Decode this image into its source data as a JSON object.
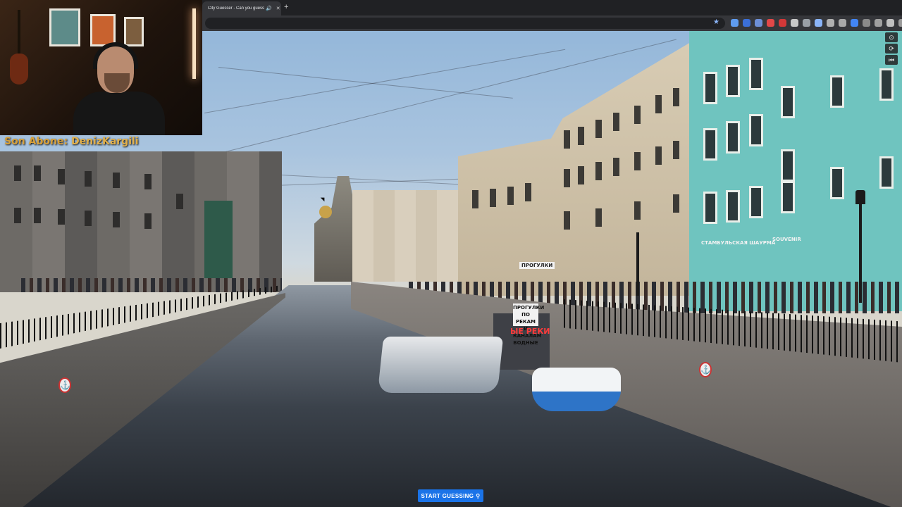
{
  "browser": {
    "tab_title": "City Guesser - Can you guess",
    "new_tab_glyph": "+",
    "close_glyph": "✕",
    "audio_glyph": "🔊",
    "star_glyph": "★"
  },
  "overlay": {
    "subscriber_label": "Son Abone:",
    "subscriber_name": "DenizKargili"
  },
  "scene": {
    "shop_signs": {
      "kiosk_sign": "ПРОГУЛКИ ПО РЕКАМ И КАНАЛАМ ВОДНЫЕ",
      "red_sign": "ЫЕ РЕКИ",
      "small_sign": "ПРОГУЛКИ",
      "left_sign": "СТАМБУЛЬСКАЯ ШАУРМА",
      "right_sign": "SOUVENIR"
    }
  },
  "controls": {
    "compass_glyph": "⊙",
    "reset_glyph": "⟳",
    "back_glyph": "⏮"
  },
  "start_button": {
    "label": "START GUESSING",
    "pin_glyph": "⚲"
  }
}
